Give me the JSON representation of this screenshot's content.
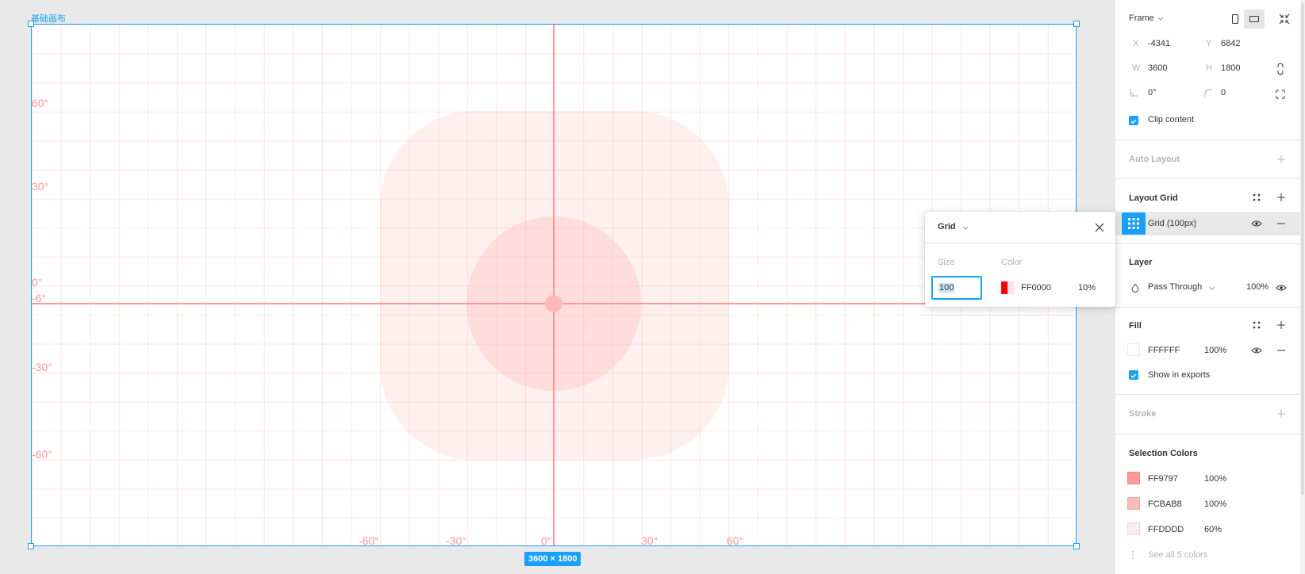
{
  "canvas": {
    "frame_label": "基础画布",
    "dimension_badge": "3600 × 1800",
    "left_degree_labels": [
      "60°",
      "30°",
      "0°",
      "-6°",
      "-30°",
      "-60°"
    ],
    "bottom_degree_labels": [
      "-60°",
      "-30°",
      "0°",
      "30°",
      "60°"
    ],
    "colors": {
      "selection_blue": "#18a0fb",
      "grid_red": "#FF0000",
      "guide_pink": "#FF9797",
      "circle_pink": "#FCBAB8",
      "outer_pink": "#FFDDDD"
    }
  },
  "grid_popover": {
    "title": "Grid",
    "size_label": "Size",
    "color_label": "Color",
    "size_value": "100",
    "color_hex": "FF0000",
    "color_opacity": "10%",
    "icons": [
      "chevron-down-icon",
      "close-icon"
    ]
  },
  "panel": {
    "frame": {
      "type_label": "Frame",
      "x_label": "X",
      "x_value": "-4341",
      "y_label": "Y",
      "y_value": "6842",
      "w_label": "W",
      "w_value": "3600",
      "h_label": "H",
      "h_value": "1800",
      "rotation_value": "0°",
      "radius_value": "0",
      "clip_content_label": "Clip content",
      "clip_content_checked": true
    },
    "auto_layout": {
      "title": "Auto Layout"
    },
    "layout_grid": {
      "title": "Layout Grid",
      "grid_item_label": "Grid (100px)"
    },
    "layer": {
      "title": "Layer",
      "blend_mode": "Pass Through",
      "opacity": "100%"
    },
    "fill": {
      "title": "Fill",
      "hex": "FFFFFF",
      "opacity": "100%",
      "show_in_exports_label": "Show in exports",
      "show_in_exports_checked": true
    },
    "stroke": {
      "title": "Stroke"
    },
    "selection_colors": {
      "title": "Selection Colors",
      "items": [
        {
          "hex": "FF9797",
          "opacity": "100%",
          "color": "#FF9797"
        },
        {
          "hex": "FCBAB8",
          "opacity": "100%",
          "color": "#FCBAB8"
        },
        {
          "hex": "FFDDDD",
          "opacity": "60%",
          "color": "#FFDDDD"
        }
      ],
      "see_all_label": "See all 5 colors"
    }
  }
}
